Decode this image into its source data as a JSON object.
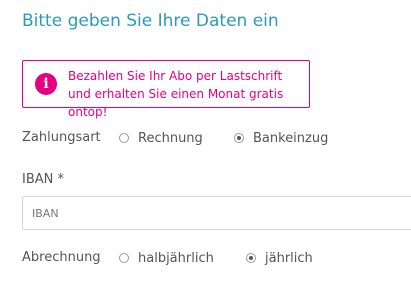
{
  "form": {
    "title": "Bitte geben Sie Ihre Daten ein",
    "notice": {
      "icon": "info-icon",
      "icon_glyph": "i",
      "text": "Bezahlen Sie Ihr Abo per Lastschrift und erhalten Sie einen Monat gratis ontop!",
      "accent_color": "#e4007e"
    },
    "payment_method": {
      "label": "Zahlungsart",
      "options": [
        {
          "label": "Rechnung",
          "selected": false
        },
        {
          "label": "Bankeinzug",
          "selected": true
        }
      ]
    },
    "iban": {
      "label": "IBAN *",
      "placeholder": "IBAN",
      "value": ""
    },
    "billing": {
      "label": "Abrechnung",
      "options": [
        {
          "label": "halbjährlich",
          "selected": false
        },
        {
          "label": "jährlich",
          "selected": true
        }
      ]
    }
  }
}
